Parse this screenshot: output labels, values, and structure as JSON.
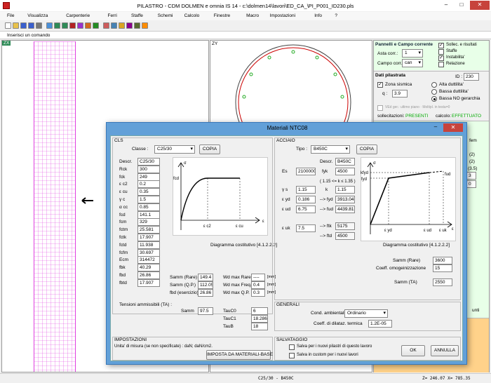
{
  "window": {
    "title": "PILASTRO - CDM DOLMEN e omnia IS 14 - c:\\dolmen14\\lavori\\ED_CA_\\PI_P001_ID230.pls"
  },
  "menu": [
    "File",
    "Visualizza",
    "Carpenterie",
    "Ferri",
    "Staffe",
    "Schemi",
    "Calcolo",
    "Finestre",
    "Macro",
    "Impostazioni",
    "Info",
    "?"
  ],
  "toolbar_icons": [
    {
      "name": "new-file-icon",
      "color": "#ffffff"
    },
    {
      "name": "open-folder-icon",
      "color": "#e8c14a"
    },
    {
      "name": "save-icon",
      "color": "#3a5fcd"
    },
    {
      "name": "save-as-icon",
      "color": "#3a5fcd"
    },
    {
      "name": "print-icon",
      "color": "#777777"
    },
    {
      "name": "preview-icon",
      "color": "#4a90d9"
    },
    {
      "name": "rebar-icon",
      "color": "#2e8b57"
    },
    {
      "name": "stirrup-icon",
      "color": "#2e8b57"
    },
    {
      "name": "section-icon",
      "color": "#b22222"
    },
    {
      "name": "diagram-icon",
      "color": "#9932cc"
    },
    {
      "name": "check-icon",
      "color": "#d2691e"
    },
    {
      "name": "calc-icon",
      "color": "#228b22"
    },
    {
      "name": "import-icon",
      "color": "#cd5c5c"
    },
    {
      "name": "export-icon",
      "color": "#4682b4"
    },
    {
      "name": "layers-icon",
      "color": "#daa520"
    },
    {
      "name": "macro-icon",
      "color": "#8b008b"
    },
    {
      "name": "material-icon",
      "color": "#556b2f"
    },
    {
      "name": "paint-icon",
      "color": "#ff8c00"
    }
  ],
  "command": {
    "placeholder": "Inserisci un comando"
  },
  "panes": {
    "left": "ZX",
    "center": "ZY"
  },
  "right_panel": {
    "title": "Pannelli e Campo corrente",
    "asta_label": "Asta corr.:",
    "asta_value": "1",
    "campo_label": "Campo corr.:",
    "campo_value": "can",
    "checks": [
      {
        "label": "Sollec. e risultati",
        "checked": true
      },
      {
        "label": "Staffe",
        "checked": false
      },
      {
        "label": "Instabilita'",
        "checked": true
      },
      {
        "label": "Relazione",
        "checked": false
      }
    ],
    "dati_title": "Dati pilastrata",
    "id_label": "ID :",
    "id_value": "230",
    "zona_label": "Zona sismica",
    "q_label": "q :",
    "q_value": "3.9",
    "duttilita": [
      "Alta duttilita'",
      "Bassa duttilita'",
      "Bassa NO gerarchia"
    ],
    "vedi_text": "VEd ger.: ultimo piano · Moltipl. in testa=0",
    "sollecitazioni": "sollecitazioni:",
    "presenti": "PRESENTI",
    "calcolo": "calcolo:",
    "effettuato": "EFFETTUATO",
    "partial": [
      "fem",
      "(2)",
      "(2)",
      "(3.5)",
      "3",
      "0",
      "unti"
    ]
  },
  "status": {
    "center": "C25/30 - B450C",
    "right": "Z= 246.07  X= 785.35"
  },
  "dialog": {
    "title": "Materiali NTC08",
    "cls": {
      "group": "CLS",
      "classe_label": "Classe :",
      "classe_value": "C25/30",
      "copia": "COPIA",
      "props": [
        {
          "label": "Descr.",
          "value": "C25/30"
        },
        {
          "label": "Rck",
          "value": "300"
        },
        {
          "label": "fck",
          "value": "249"
        },
        {
          "label": "ε c2",
          "value": "0.2"
        },
        {
          "label": "ε cu",
          "value": "0.35"
        },
        {
          "label": "γ c",
          "value": "1.5"
        },
        {
          "label": "α cc",
          "value": "0.85"
        },
        {
          "label": "fcd",
          "value": "141.1"
        },
        {
          "label": "fcm",
          "value": "329"
        },
        {
          "label": "fctm",
          "value": "25.581"
        },
        {
          "label": "fctk",
          "value": "17.907"
        },
        {
          "label": "fctd",
          "value": "11.938"
        },
        {
          "label": "fcfm",
          "value": "30.697"
        },
        {
          "label": "Ecm",
          "value": "314472"
        },
        {
          "label": "fbk",
          "value": "40.29"
        },
        {
          "label": "fbd",
          "value": "26.86"
        },
        {
          "label": "fbtd",
          "value": "17.907"
        }
      ],
      "diag_caption": "Diagramma costitutivo [4.1.2.2.2]",
      "diag_labels": {
        "sigma": "σ",
        "fcd": "fcd",
        "ec2": "ε c2",
        "ecu": "ε cu",
        "eps": "ε"
      },
      "samm": [
        {
          "label": "Samm (Rare)",
          "value": "149.4"
        },
        {
          "label": "Samm (Q.P.)",
          "value": "112.05"
        },
        {
          "label": "fbd (esercizio)",
          "value": "26.86"
        }
      ],
      "wd": [
        {
          "label": "Wd max Rare",
          "value": "----",
          "unit": "[mm]"
        },
        {
          "label": "Wd max Freq.",
          "value": "0.4",
          "unit": "[mm]"
        },
        {
          "label": "Wd max Q.P.",
          "value": "0.3",
          "unit": "[mm]"
        }
      ],
      "tens_title": "Tensioni ammissibili (TA) :",
      "samm_ta_label": "Samm",
      "samm_ta_value": "97.5",
      "tau": [
        {
          "label": "TauC0",
          "value": "6"
        },
        {
          "label": "TauC1",
          "value": "18.286"
        },
        {
          "label": "TauB",
          "value": "18"
        }
      ]
    },
    "acciaio": {
      "group": "ACCIAIO",
      "tipo_label": "Tipo :",
      "tipo_value": "B450C",
      "copia": "COPIA",
      "descr_label": "Descr.",
      "descr_value": "B450C",
      "es_label": "Es",
      "es_value": "2100000",
      "fyk_label": "fyk",
      "fyk_value": "4500",
      "ratio_text": "( 1.15 <= k ≤ 1.35 )",
      "gs_label": "γ s",
      "gs_value": "1.15",
      "k_label": "k",
      "k_value": "1.15",
      "eyd_label": "ε yd",
      "eyd_value": "0.186",
      "fyd_label": "--> fyd",
      "fyd_value": "3913.04",
      "eud_label": "ε ud",
      "eud_value": "6.75",
      "fud_label": "--> fud",
      "fud_value": "4439.81",
      "euk_label": "ε uk",
      "euk_value": "7.5",
      "ftk_label": "--> ftk",
      "ftk_value": "5175",
      "ftd_label": "--> ftd",
      "ftd_value": "4500",
      "diag_caption": "Diagramma costitutivo [4.1.2.2.2]",
      "diag_labels": {
        "sigma": "σ",
        "kfyd": "kfyd",
        "fyd": "fyd",
        "fud": "fud",
        "eyd": "ε yd",
        "eud": "ε ud",
        "euk": "ε uk",
        "eps": "ε"
      },
      "samm_rare_label": "Samm (Rare)",
      "samm_rare_value": "3600",
      "coeff_label": "Coeff. omogeinizzazione",
      "coeff_value": "15",
      "samm_ta_label": "Samm (TA)",
      "samm_ta_value": "2550"
    },
    "generali": {
      "group": "GENERALI",
      "cond_label": "Cond. ambientali",
      "cond_value": "Ordinario",
      "coeff_label": "Coeff. di dilataz. termica",
      "coeff_value": "1.2E-05"
    },
    "impostazioni": {
      "group": "IMPOSTAZIONI",
      "text": "Unita' di misura (se non specificate) : daN; daN/cm2.",
      "button": "IMPOSTA DA MATERIALI-BASE"
    },
    "salvataggio": {
      "group": "SALVATAGGIO",
      "opt1": "Salva per i nuovi pilastri di questo lavoro",
      "opt2": "Salva in custom per i nuovi lavori"
    },
    "ok": "OK",
    "annulla": "ANNULLA"
  }
}
